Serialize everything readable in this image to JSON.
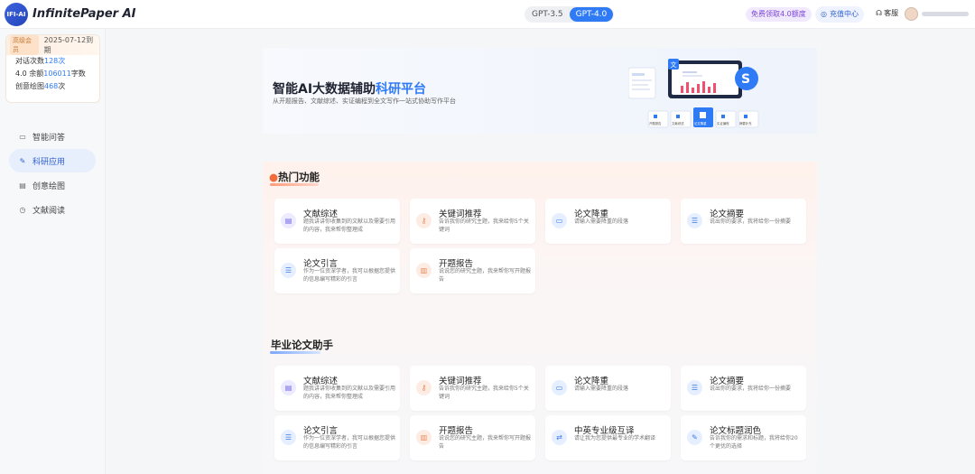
{
  "header": {
    "logo_badge": "IFI-AI",
    "app_title": "InfinitePaper AI",
    "models": [
      "GPT-3.5",
      "GPT-4.0"
    ],
    "free_quota": "免费领取4.0额度",
    "recharge": "充值中心",
    "service": "客服"
  },
  "member": {
    "level": "高级会员",
    "expire": "2025-07-12到期",
    "stats": [
      {
        "label": "对话次数",
        "num": "128",
        "unit": "次"
      },
      {
        "label": "4.0 余额",
        "num": "106011",
        "unit": "字数"
      },
      {
        "label": "创意绘图",
        "num": "468",
        "unit": "次"
      }
    ]
  },
  "nav": [
    {
      "label": "智能问答",
      "icon": "chat-icon"
    },
    {
      "label": "科研应用",
      "icon": "pen-icon",
      "active": true
    },
    {
      "label": "创意绘图",
      "icon": "image-icon"
    },
    {
      "label": "文献阅读",
      "icon": "book-icon"
    }
  ],
  "banner": {
    "title_main": "智能AI大数据辅助",
    "title_highlight": "科研平台",
    "subtitle": "从开题报告、文献综述、实证编程到全文写作一站式协助写作平台",
    "art_labels": [
      "开题报告",
      "文献综述",
      "论文降重",
      "实证编程",
      "摘要补充"
    ]
  },
  "hot": {
    "title": "热门功能",
    "cards": [
      {
        "title": "文献综述",
        "desc": "题我讲讲你收集到的文献以及需要引用的内容，我来帮你整理成",
        "icon": "document-icon",
        "color": "purple"
      },
      {
        "title": "关键词推荐",
        "desc": "告诉我你的研究主题，我来给你5个关键词",
        "icon": "key-icon",
        "color": "orange"
      },
      {
        "title": "论文降重",
        "desc": "请输入需要降重的段落",
        "icon": "rewrite-icon",
        "color": "blue"
      },
      {
        "title": "论文摘要",
        "desc": "说出你的要求，我将给你一份摘要",
        "icon": "abstract-icon",
        "color": "blue"
      },
      {
        "title": "论文引言",
        "desc": "作为一位资深学者，我可以根据您提供的信息编写精彩的引言",
        "icon": "intro-icon",
        "color": "blue"
      },
      {
        "title": "开题报告",
        "desc": "说说您的研究主题，我来帮你写开题报告",
        "icon": "report-icon",
        "color": "orange"
      }
    ]
  },
  "thesis": {
    "title": "毕业论文助手",
    "cards": [
      {
        "title": "文献综述",
        "desc": "题我讲讲你收集到的文献以及需要引用的内容，我来帮你整理成",
        "icon": "document-icon",
        "color": "purple"
      },
      {
        "title": "关键词推荐",
        "desc": "告诉我你的研究主题，我来给你5个关键词",
        "icon": "key-icon",
        "color": "orange"
      },
      {
        "title": "论文降重",
        "desc": "请输入需要降重的段落",
        "icon": "rewrite-icon",
        "color": "blue"
      },
      {
        "title": "论文摘要",
        "desc": "说出你的要求，我将给你一份摘要",
        "icon": "abstract-icon",
        "color": "blue"
      },
      {
        "title": "论文引言",
        "desc": "作为一位资深学者，我可以根据您提供的信息编写精彩的引言",
        "icon": "intro-icon",
        "color": "blue"
      },
      {
        "title": "开题报告",
        "desc": "说说您的研究主题，我来帮你写开题报告",
        "icon": "report-icon",
        "color": "orange"
      },
      {
        "title": "中英专业级互译",
        "desc": "请让我为您提供最专业的学术翻译",
        "icon": "translate-icon",
        "color": "blue"
      },
      {
        "title": "论文标题润色",
        "desc": "告诉我你的需求和标题，我将给你20个更优的选择",
        "icon": "polish-icon",
        "color": "blue"
      }
    ]
  }
}
